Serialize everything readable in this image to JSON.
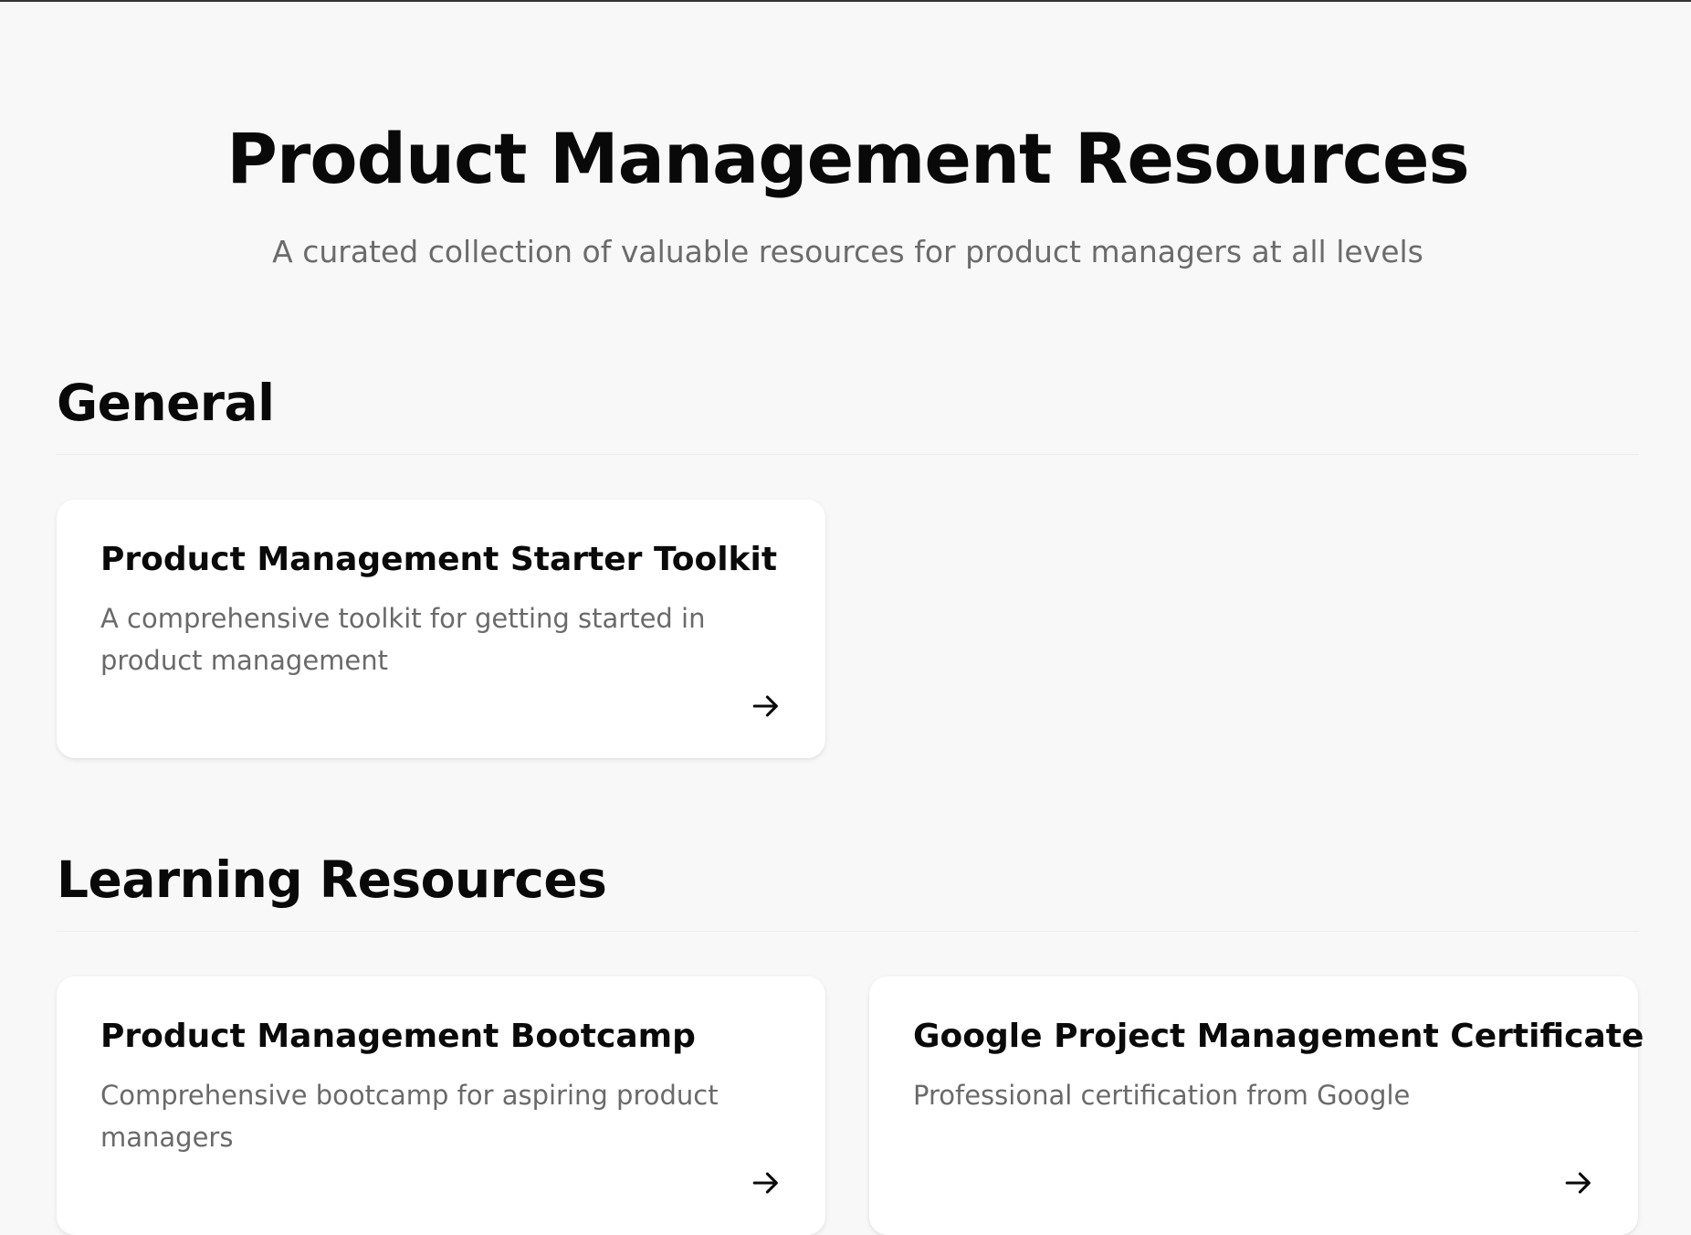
{
  "hero": {
    "title": "Product Management Resources",
    "subtitle": "A curated collection of valuable resources for product managers at all levels"
  },
  "sections": [
    {
      "heading": "General",
      "cards": [
        {
          "title": "Product Management Starter Toolkit",
          "description": "A comprehensive toolkit for getting started in product management",
          "icon": "arrow-right-icon"
        }
      ]
    },
    {
      "heading": "Learning Resources",
      "cards": [
        {
          "title": "Product Management Bootcamp",
          "description": "Comprehensive bootcamp for aspiring product managers",
          "icon": "arrow-right-icon"
        },
        {
          "title": "Google Project Management Certificate",
          "description": "Professional certification from Google",
          "icon": "arrow-right-icon"
        }
      ]
    }
  ]
}
